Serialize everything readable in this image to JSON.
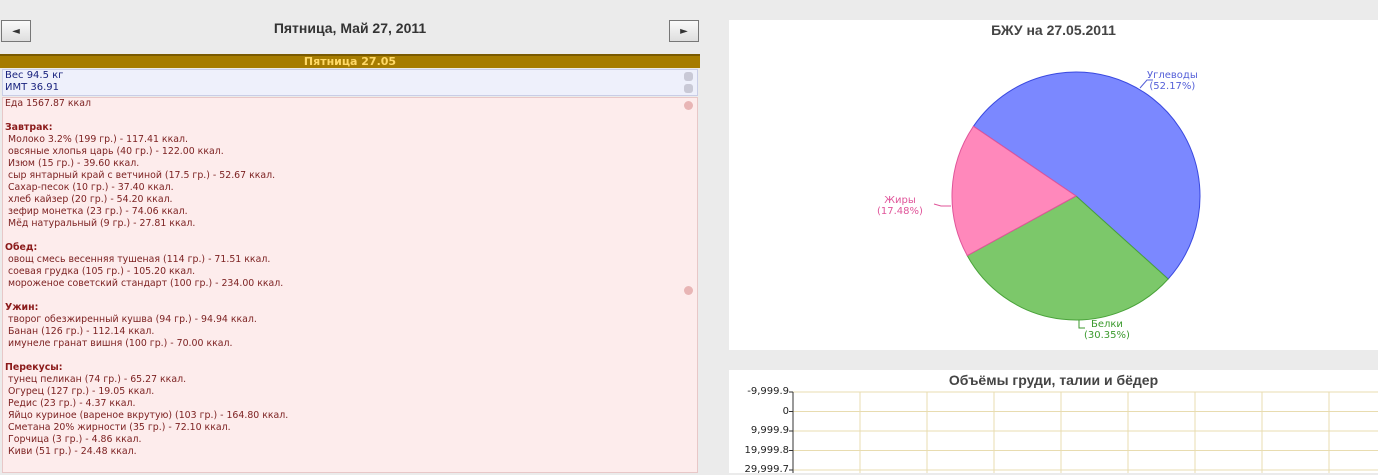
{
  "nav": {
    "prev_label": "◄",
    "next_label": "►",
    "date_title": "Пятница, Май 27, 2011"
  },
  "day": {
    "header": "Пятница 27.05",
    "weight": "Вес 94.5 кг",
    "bmi": "ИМТ 36.91",
    "food_total": "Еда 1567.87 ккал",
    "sections": [
      {
        "title": "Завтрак:",
        "items": [
          "Молоко 3.2% (199 гр.) - 117.41 ккал.",
          "овсяные хлопья царь (40 гр.) - 122.00 ккал.",
          "Изюм (15 гр.) - 39.60 ккал.",
          "сыр янтарный край с ветчиной (17.5 гр.) - 52.67 ккал.",
          "Сахар-песок (10 гр.) - 37.40 ккал.",
          "хлеб кайзер (20 гр.) - 54.20 ккал.",
          "зефир монетка (23 гр.) - 74.06 ккал.",
          "Мёд натуральный (9 гр.) - 27.81 ккал."
        ]
      },
      {
        "title": "Обед:",
        "items": [
          "овощ смесь весенняя тушеная (114 гр.) - 71.51 ккал.",
          "соевая грудка (105 гр.) - 105.20 ккал.",
          "мороженое советский стандарт (100 гр.) - 234.00 ккал."
        ]
      },
      {
        "title": "Ужин:",
        "items": [
          "творог обезжиренный кушва (94 гр.) - 94.94 ккал.",
          "Банан (126 гр.) - 112.14 ккал.",
          "имунеле гранат вишня (100 гр.) - 70.00 ккал."
        ]
      },
      {
        "title": "Перекусы:",
        "items": [
          "тунец пеликан (74 гр.) - 65.27 ккал.",
          "Огурец (127 гр.) - 19.05 ккал.",
          "Редис (23 гр.) - 4.37 ккал.",
          "Яйцо куриное (вареное вкрутую) (103 гр.) - 164.80 ккал.",
          "Сметана 20% жирности (35 гр.) - 72.10 ккал.",
          "Горчица (3 гр.) - 4.86 ккал.",
          "Киви (51 гр.) - 24.48 ккал."
        ]
      }
    ]
  },
  "chart_data": [
    {
      "type": "pie",
      "title": "БЖУ на 27.05.2011",
      "slices": [
        {
          "name": "Углеводы",
          "value": 52.17,
          "label": "(52.17%)",
          "color": "#7b88ff"
        },
        {
          "name": "Белки",
          "value": 30.35,
          "label": "(30.35%)",
          "color": "#7cc86a"
        },
        {
          "name": "Жиры",
          "value": 17.48,
          "label": "(17.48%)",
          "color": "#ff88bb"
        }
      ]
    },
    {
      "type": "line",
      "title": "Объёмы груди, талии и бёдер",
      "y_ticks": [
        "-9,999.9",
        "0",
        "9,999.9",
        "19,999.8",
        "29,999.7"
      ],
      "grid": true
    }
  ]
}
